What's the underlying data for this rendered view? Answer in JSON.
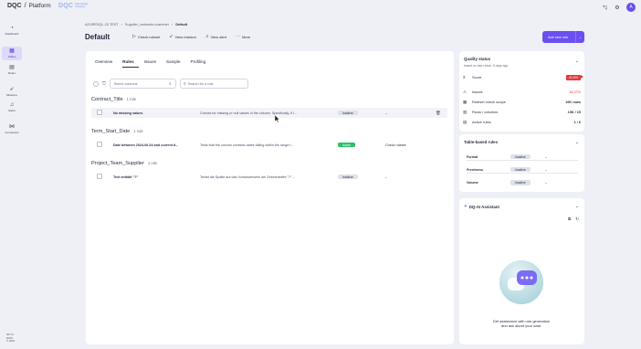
{
  "header": {
    "brand": "DQC",
    "platform": "Platform",
    "brand2": "DQC",
    "brand2_sub1": "Data Quality",
    "brand2_sub2": "Company",
    "avatar": "A"
  },
  "sidebar": {
    "items": [
      {
        "label": "Dashboard",
        "icon": "gauge-icon",
        "glyph": "◔"
      },
      {
        "label": "Tables",
        "icon": "tables-icon",
        "glyph": "▦"
      },
      {
        "label": "Rules",
        "icon": "rules-icon",
        "glyph": "▤"
      },
      {
        "label": "Missions",
        "icon": "missions-icon",
        "glyph": "➶"
      },
      {
        "label": "Alerts",
        "icon": "bell-icon",
        "glyph": "🔔"
      },
      {
        "label": "Connectors",
        "icon": "connectors-icon",
        "glyph": "⋈"
      }
    ],
    "footer": [
      "NK 72",
      "DATA",
      "© 2024"
    ]
  },
  "breadcrumb": {
    "items": [
      "AZURESQL-20 TEST",
      "Supplier_contracts customer",
      "Default"
    ]
  },
  "page": {
    "title": "Default"
  },
  "actions": {
    "check_ruleset": "Check ruleset",
    "view_mission": "View mission",
    "view_alert": "View alert",
    "more": "More",
    "add_rule": "Add new rule"
  },
  "tabs": [
    "Overview",
    "Rules",
    "Issues",
    "Sample",
    "Profiling"
  ],
  "filters": {
    "select_placeholder": "Select columns",
    "search_placeholder": "Search for a rule"
  },
  "groups": [
    {
      "title": "Contract_Title",
      "count": "1 rule",
      "rules": [
        {
          "name": "No missing values",
          "description": "Checks for missing or null values in the column. Specifically, it i...",
          "status": "Inactive",
          "ruleset": "–"
        }
      ]
    },
    {
      "title": "Term_Start_Date",
      "count": "1 rule",
      "rules": [
        {
          "name": "Date between 2024-06-04 and current d...",
          "description": "Tests that the column contains dates falling within the range f...",
          "status": "Active",
          "ruleset": "Check ruleset"
        }
      ]
    },
    {
      "title": "Project_Team_Supplier",
      "count": "1 rule",
      "rules": [
        {
          "name": "Text enthält \"?\"",
          "description": "Testet die Spalte auf das Vorhandensein der Zeichenkette \"?\" ...",
          "status": "Inactive",
          "ruleset": "–"
        }
      ]
    }
  ],
  "quality": {
    "title": "Quality status",
    "subtitle": "based on last check: 5 days ago",
    "rows": [
      {
        "label": "Score",
        "value": "81.6%",
        "icon": "sigma-icon",
        "glyph": "Σ"
      },
      {
        "label": "Issues",
        "value": "18.37%",
        "icon": "warning-icon",
        "glyph": "⚠"
      },
      {
        "label": "Ruleset check scope",
        "value": "19K rows",
        "icon": "scope-icon",
        "glyph": "▦"
      },
      {
        "label": "Rows / columns",
        "value": "19K / 15",
        "icon": "grid-icon",
        "glyph": "▥"
      },
      {
        "label": "Active rules",
        "value": "1 / 6",
        "icon": "rules-icon",
        "glyph": "▤"
      }
    ]
  },
  "table_rules": {
    "title": "Table-based rules",
    "rows": [
      {
        "name": "Format",
        "status": "Inactive",
        "ruleset": "–"
      },
      {
        "name": "Freshness",
        "status": "Inactive",
        "ruleset": "–"
      },
      {
        "name": "Volume",
        "status": "Inactive",
        "ruleset": "–"
      }
    ]
  },
  "ai": {
    "title": "DQ-AI Assistant",
    "text": "Get assistance with rule generation and ask about your data."
  },
  "colors": {
    "accent": "#6b4ff0",
    "active": "#2ebd6b",
    "danger": "#e23b3b"
  }
}
